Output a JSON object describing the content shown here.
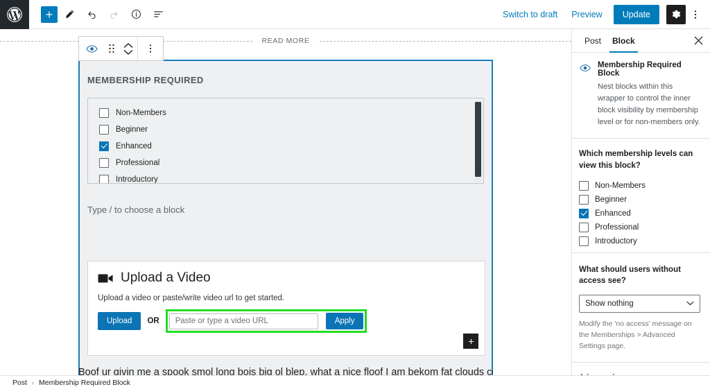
{
  "topbar": {
    "logo_icon": "wordpress-icon",
    "tools": [
      {
        "name": "add-block-button",
        "icon": "plus-icon",
        "variant": "primary"
      },
      {
        "name": "edit-tool-button",
        "icon": "pencil-icon",
        "variant": "plain"
      },
      {
        "name": "undo-button",
        "icon": "undo-arrow-icon",
        "variant": "plain"
      },
      {
        "name": "redo-button",
        "icon": "redo-arrow-icon",
        "variant": "disabled"
      },
      {
        "name": "details-button",
        "icon": "info-circle-icon",
        "variant": "plain"
      },
      {
        "name": "list-view-button",
        "icon": "list-view-icon",
        "variant": "plain"
      }
    ],
    "switch_to_draft": "Switch to draft",
    "preview": "Preview",
    "update": "Update",
    "settings_icon": "gear-icon",
    "more_icon": "kebab-menu-icon"
  },
  "editor": {
    "read_more_label": "READ MORE",
    "block_toolbar": {
      "visibility_icon": "eye-icon",
      "drag_icon": "drag-handle-icon",
      "move_up_icon": "chevron-up-icon",
      "move_down_icon": "chevron-down-icon",
      "options_icon": "kebab-menu-icon"
    },
    "block_title": "MEMBERSHIP REQUIRED",
    "levels": [
      {
        "label": "Non-Members",
        "checked": false
      },
      {
        "label": "Beginner",
        "checked": false
      },
      {
        "label": "Enhanced",
        "checked": true
      },
      {
        "label": "Professional",
        "checked": false
      },
      {
        "label": "Introductory",
        "checked": false
      }
    ],
    "appender_placeholder": "Type / to choose a block",
    "video_block": {
      "icon": "video-camera-icon",
      "title": "Upload a Video",
      "subtitle": "Upload a video or paste/write video url to get started.",
      "upload_label": "Upload",
      "or_label": "OR",
      "url_placeholder": "Paste or type a video URL",
      "url_value": "",
      "apply_label": "Apply",
      "highlight_color": "#22dd22"
    },
    "inner_appender_icon": "plus-icon",
    "body_paragraph": "Boof ur givin me a spook smol long bois big ol blep, what a nice floof I am bekom fat clouds corgo"
  },
  "sidebar": {
    "tabs": [
      {
        "label": "Post",
        "active": false
      },
      {
        "label": "Block",
        "active": true
      }
    ],
    "close_icon": "close-x-icon",
    "block_icon": "eye-icon",
    "block_name": "Membership Required Block",
    "block_description": "Nest blocks within this wrapper to control the inner block visibility by membership level or for non-members only.",
    "levels_question": "Which membership levels can view this block?",
    "levels": [
      {
        "label": "Non-Members",
        "checked": false
      },
      {
        "label": "Beginner",
        "checked": false
      },
      {
        "label": "Enhanced",
        "checked": true
      },
      {
        "label": "Professional",
        "checked": false
      },
      {
        "label": "Introductory",
        "checked": false
      }
    ],
    "access_question": "What should users without access see?",
    "access_select_value": "Show nothing",
    "access_select_icon": "chevron-down-icon",
    "access_help": "Modify the 'no access' message on the Memberships > Advanced Settings page.",
    "advanced_label": "Advanced",
    "advanced_icon": "chevron-down-icon"
  },
  "breadcrumb": {
    "items": [
      "Post",
      "Membership Required Block"
    ],
    "separator": "›"
  },
  "colors": {
    "accent": "#007cba",
    "block_border": "#1a7cb8",
    "block_bg": "#eef0f1",
    "highlight": "#22dd22",
    "dark": "#1e1e1e"
  }
}
